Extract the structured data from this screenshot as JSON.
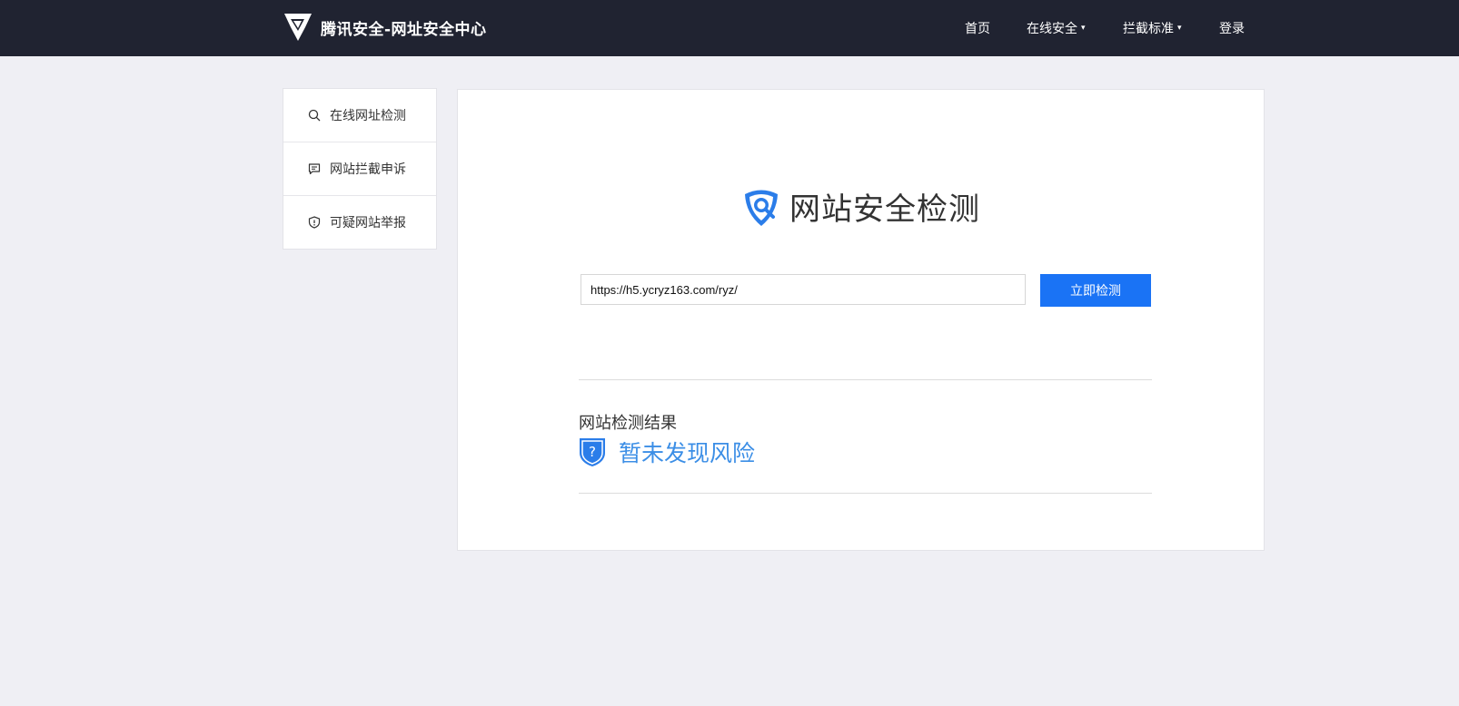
{
  "header": {
    "brand": "腾讯安全-网址安全中心",
    "nav": [
      {
        "label": "首页"
      },
      {
        "label": "在线安全",
        "caret": "▾"
      },
      {
        "label": "拦截标准",
        "caret": "▾"
      },
      {
        "label": "登录"
      }
    ]
  },
  "sidebar": {
    "items": [
      {
        "label": "在线网址检测",
        "icon": "search-icon"
      },
      {
        "label": "网站拦截申诉",
        "icon": "message-icon"
      },
      {
        "label": "可疑网站举报",
        "icon": "shield-alert-icon"
      }
    ]
  },
  "main": {
    "title": "网站安全检测",
    "url_value": "https://h5.ycryz163.com/ryz/",
    "check_button": "立即检测",
    "result_label": "网站检测结果",
    "result_text": "暂未发现风险"
  },
  "colors": {
    "header_bg": "#202331",
    "page_bg": "#efeff4",
    "accent": "#1a73f5",
    "result_blue": "#3b8ee6"
  }
}
